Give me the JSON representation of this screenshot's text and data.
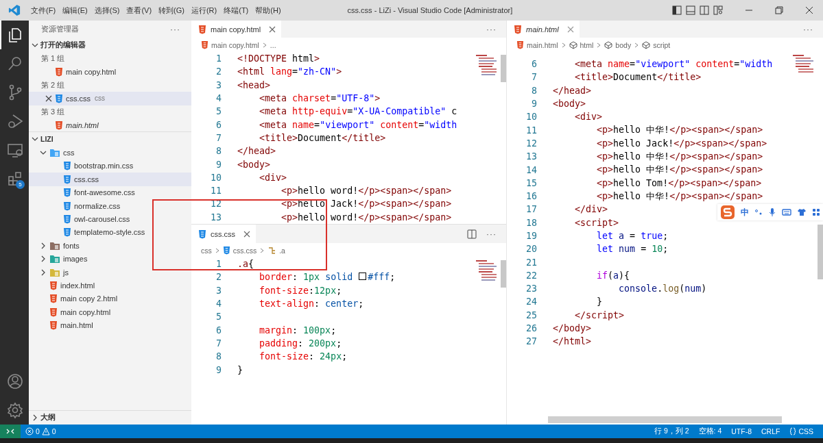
{
  "window": {
    "title": "css.css - LiZi - Visual Studio Code [Administrator]"
  },
  "menu": [
    "文件(F)",
    "编辑(E)",
    "选择(S)",
    "查看(V)",
    "转到(G)",
    "运行(R)",
    "终端(T)",
    "帮助(H)"
  ],
  "activity_bar": [
    {
      "kind": "explorer",
      "selected": true
    },
    {
      "kind": "search",
      "selected": false
    },
    {
      "kind": "scm",
      "selected": false
    },
    {
      "kind": "debug",
      "selected": false
    },
    {
      "kind": "remote",
      "selected": false
    },
    {
      "kind": "extensions",
      "selected": false,
      "badge": "5"
    }
  ],
  "activity_bottom": [
    {
      "kind": "account"
    },
    {
      "kind": "settings"
    }
  ],
  "explorer": {
    "title": "资源管理器",
    "more": "···",
    "open_editors": {
      "title": "打开的编辑器",
      "expanded": true,
      "groups": [
        {
          "label": "第 1 组",
          "files": [
            {
              "name": "main copy.html",
              "kind": "html",
              "preview": false,
              "selected": false
            }
          ]
        },
        {
          "label": "第 2 组",
          "files": [
            {
              "name": "css.css",
              "description": "css",
              "kind": "css",
              "preview": false,
              "selected": true
            }
          ]
        },
        {
          "label": "第 3 组",
          "files": [
            {
              "name": "main.html",
              "kind": "html",
              "preview": true,
              "selected": false
            }
          ]
        }
      ]
    },
    "folder": {
      "title": "LIZI",
      "expanded": true,
      "items": [
        {
          "name": "css",
          "kind": "folder",
          "expanded": true,
          "selected": false,
          "children": [
            {
              "name": "bootstrap.min.css",
              "kind": "css",
              "selected": false
            },
            {
              "name": "css.css",
              "kind": "css",
              "selected": true
            },
            {
              "name": "font-awesome.css",
              "kind": "css",
              "selected": false
            },
            {
              "name": "normalize.css",
              "kind": "css",
              "selected": false
            },
            {
              "name": "owl-carousel.css",
              "kind": "css",
              "selected": false
            },
            {
              "name": "templatemo-style.css",
              "kind": "css",
              "selected": false
            }
          ]
        },
        {
          "name": "fonts",
          "kind": "folder",
          "expanded": false,
          "selected": false
        },
        {
          "name": "images",
          "kind": "folder",
          "expanded": false,
          "selected": false
        },
        {
          "name": "js",
          "kind": "folder",
          "expanded": false,
          "selected": false
        },
        {
          "name": "index.html",
          "kind": "html",
          "selected": false
        },
        {
          "name": "main copy 2.html",
          "kind": "html",
          "selected": false
        },
        {
          "name": "main copy.html",
          "kind": "html",
          "selected": false
        },
        {
          "name": "main.html",
          "kind": "html",
          "selected": false
        }
      ]
    },
    "outline": {
      "title": "大纲",
      "expanded": false
    }
  },
  "editors": [
    {
      "kind": "html",
      "tab": {
        "label": "main copy.html",
        "preview": false
      },
      "more": "···",
      "breadcrumb": [
        {
          "label": "main copy.html",
          "kind": "html"
        },
        {
          "label": "..."
        }
      ],
      "lines": [
        {
          "number": "1",
          "code": "<!DOCTYPE html>"
        },
        {
          "number": "2",
          "code": "<html lang=\"zh-CN\">"
        },
        {
          "number": "3",
          "code": "<head>"
        },
        {
          "number": "4",
          "code": "    <meta charset=\"UTF-8\">"
        },
        {
          "number": "5",
          "code": "    <meta http-equiv=\"X-UA-Compatible\" c"
        },
        {
          "number": "6",
          "code": "    <meta name=\"viewport\" content=\"width"
        },
        {
          "number": "7",
          "code": "    <title>Document</title>"
        },
        {
          "number": "8",
          "code": "</head>"
        },
        {
          "number": "9",
          "code": "<body>"
        },
        {
          "number": "10",
          "code": "    <div>"
        },
        {
          "number": "11",
          "code": "        <p>hello word!</p><span></span>"
        },
        {
          "number": "12",
          "code": "        <p>hello Jack!</p><span></span>"
        },
        {
          "number": "13",
          "code": "        <p>hello word!</p><span></span>"
        }
      ]
    },
    {
      "kind": "css",
      "tab": {
        "label": "css.css",
        "preview": false
      },
      "more": "···",
      "breadcrumb": [
        {
          "label": "css"
        },
        {
          "label": "css.css",
          "kind": "css"
        },
        {
          "label": ".a",
          "kind": "selector"
        }
      ],
      "lines": [
        {
          "number": "1",
          "code": ".a{"
        },
        {
          "number": "2",
          "code": "    border: 1px solid #fff;"
        },
        {
          "number": "3",
          "code": "    font-size:12px;"
        },
        {
          "number": "4",
          "code": "    text-align: center;"
        },
        {
          "number": "5"
        },
        {
          "number": "6",
          "code": "    margin: 100px;"
        },
        {
          "number": "7",
          "code": "    padding: 200px;"
        },
        {
          "number": "8",
          "code": "    font-size: 24px;"
        },
        {
          "number": "9",
          "code": "}"
        }
      ]
    },
    {
      "kind": "html",
      "tab": {
        "label": "main.html",
        "preview": true
      },
      "more": "···",
      "breadcrumb": [
        {
          "label": "main.html",
          "kind": "html"
        },
        {
          "label": "html",
          "kind": "element"
        },
        {
          "label": "body",
          "kind": "element"
        },
        {
          "label": "script",
          "kind": "element"
        }
      ],
      "lines": [
        {
          "number": "6",
          "code": "    <meta name=\"viewport\" content=\"width"
        },
        {
          "number": "7",
          "code": "    <title>Document</title>"
        },
        {
          "number": "8",
          "code": "</head>"
        },
        {
          "number": "9",
          "code": "<body>"
        },
        {
          "number": "10",
          "code": "    <div>"
        },
        {
          "number": "11",
          "code": "        <p>hello 中华!</p><span></span>"
        },
        {
          "number": "12",
          "code": "        <p>hello Jack!</p><span></span>"
        },
        {
          "number": "13",
          "code": "        <p>hello 中华!</p><span></span>"
        },
        {
          "number": "14",
          "code": "        <p>hello 中华!</p><span></span>"
        },
        {
          "number": "15",
          "code": "        <p>hello Tom!</p><span></span>"
        },
        {
          "number": "16",
          "code": "        <p>hello 中华!</p><span></span>"
        },
        {
          "number": "17",
          "code": "    </div>"
        },
        {
          "number": "18",
          "code": "    <script>"
        },
        {
          "number": "19",
          "code": "        let a = true;"
        },
        {
          "number": "20",
          "code": "        let num = 10;"
        },
        {
          "number": "21"
        },
        {
          "number": "22",
          "code": "        if(a){"
        },
        {
          "number": "23",
          "code": "            console.log(num)"
        },
        {
          "number": "24",
          "code": "        }"
        },
        {
          "number": "25",
          "code": "    </script>"
        },
        {
          "number": "26",
          "code": "</body>"
        },
        {
          "number": "27",
          "code": "</html>"
        }
      ]
    }
  ],
  "ime_toolbar": {
    "mode": "中"
  },
  "status_bar": {
    "errors": "0",
    "warnings": "0",
    "items": [
      {
        "label": "行 9，列 2"
      },
      {
        "label": "空格: 4"
      },
      {
        "label": "UTF-8"
      },
      {
        "label": "CRLF"
      },
      {
        "label": "CSS",
        "kind": "language"
      }
    ]
  }
}
